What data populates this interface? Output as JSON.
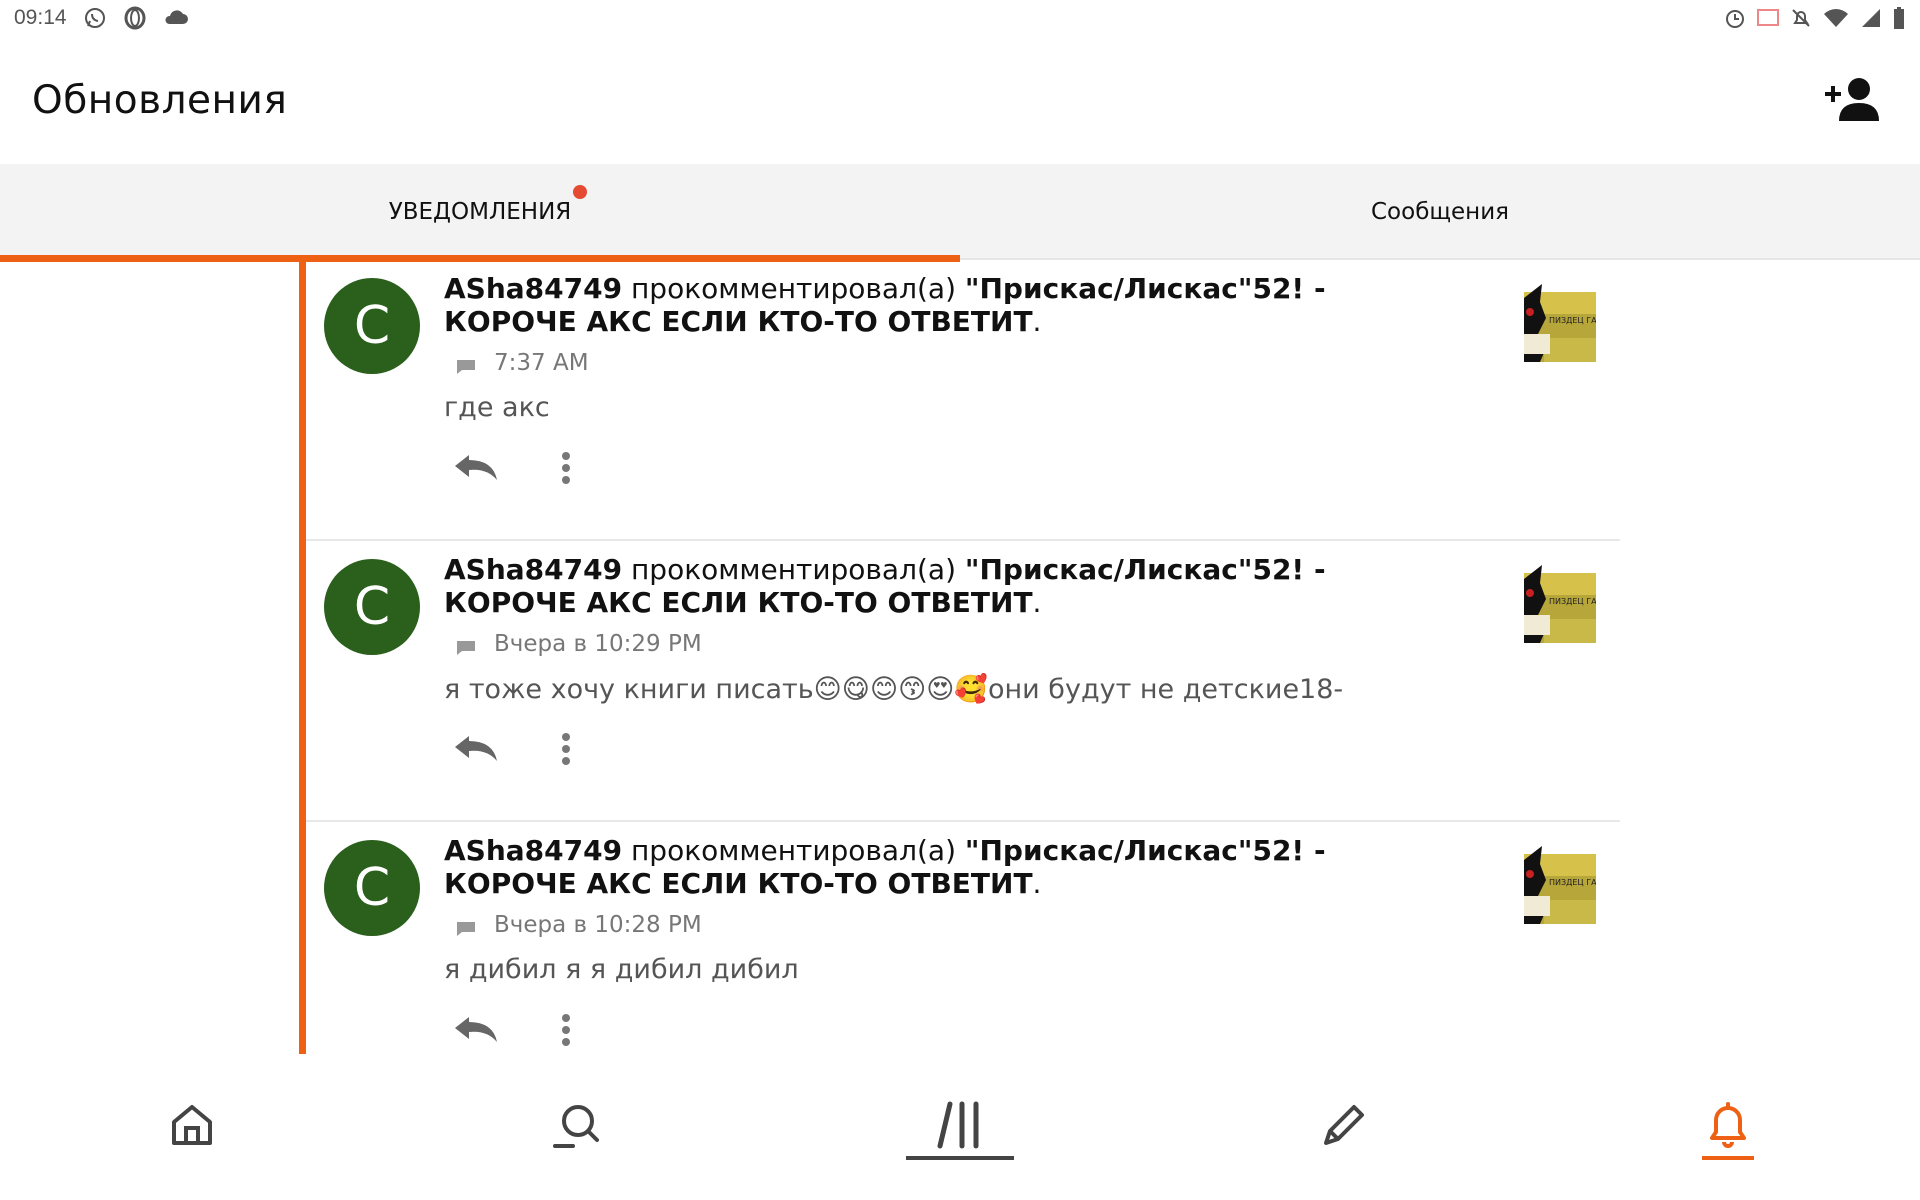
{
  "status_bar": {
    "time": "09:14",
    "left_icons": [
      "whatsapp-icon",
      "opera-icon",
      "cloud-icon"
    ],
    "right_icons": [
      "alarm-icon",
      "cast-icon",
      "mute-icon",
      "wifi-icon",
      "signal-icon",
      "battery-icon"
    ]
  },
  "header": {
    "title": "Обновления",
    "action_icon": "add-friend-icon"
  },
  "tabs": [
    {
      "label": "УВЕДОМЛЕНИЯ",
      "active": true,
      "unread": true
    },
    {
      "label": "Сообщения",
      "active": false,
      "unread": false
    }
  ],
  "notifications": [
    {
      "avatar_letter": "C",
      "user": "ASha84749",
      "action": "прокомментировал(а)",
      "target": "\"Прискас/Лискас\"52! - КОРОЧЕ АКС ЕСЛИ КТО-ТО ОТВЕТИТ",
      "end": ".",
      "time": "7:37 AM",
      "comment": "где акс",
      "thumb_text": "ПИЗДЕЦ ГА"
    },
    {
      "avatar_letter": "C",
      "user": "ASha84749",
      "action": "прокомментировал(а)",
      "target": "\"Прискас/Лискас\"52! - КОРОЧЕ АКС ЕСЛИ КТО-ТО ОТВЕТИТ",
      "end": ".",
      "time": "Вчера в 10:29 PM",
      "comment": "я тоже хочу книги писать😊😋😊😙😍🥰они будут не детские18-",
      "thumb_text": "ПИЗДЕЦ ГА"
    },
    {
      "avatar_letter": "C",
      "user": "ASha84749",
      "action": "прокомментировал(а)",
      "target": "\"Прискас/Лискас\"52! - КОРОЧЕ АКС ЕСЛИ КТО-ТО ОТВЕТИТ",
      "end": ".",
      "time": "Вчера в 10:28 PM",
      "comment": "я дибил я я дибил дибил",
      "thumb_text": "ПИЗДЕЦ ГА"
    }
  ],
  "bottom_nav": [
    {
      "icon": "home-icon",
      "active": false
    },
    {
      "icon": "search-icon",
      "active": false
    },
    {
      "icon": "library-icon",
      "active": false
    },
    {
      "icon": "write-icon",
      "active": false
    },
    {
      "icon": "notifications-bell-icon",
      "active": true
    }
  ],
  "colors": {
    "accent": "#ee6014",
    "avatar": "#2a5f1c",
    "unread_dot": "#e44b32",
    "tab_bar": "#f3f3f3"
  }
}
